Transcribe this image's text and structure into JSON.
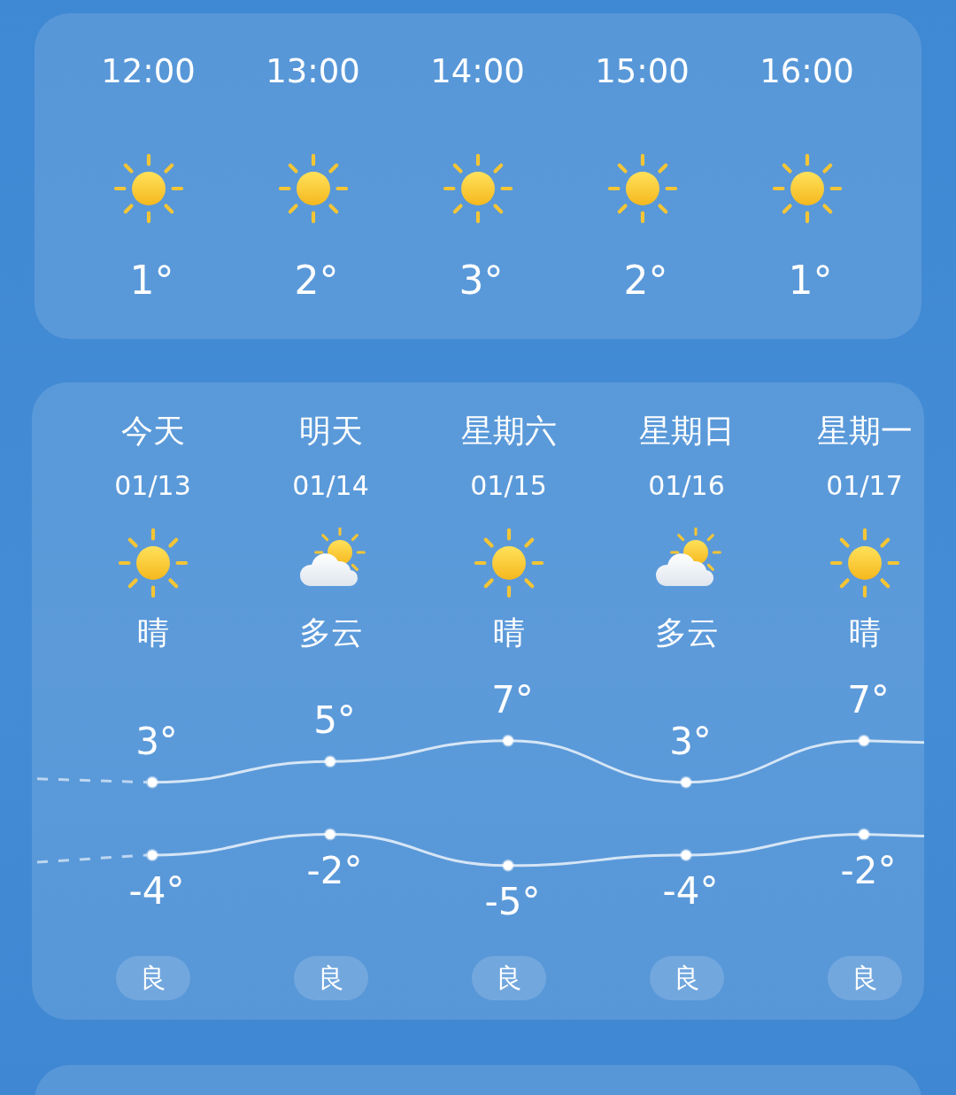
{
  "hourly": [
    {
      "time": "12:00",
      "kind": "sunny",
      "temp": "1°"
    },
    {
      "time": "13:00",
      "kind": "sunny",
      "temp": "2°"
    },
    {
      "time": "14:00",
      "kind": "sunny",
      "temp": "3°"
    },
    {
      "time": "15:00",
      "kind": "sunny",
      "temp": "2°"
    },
    {
      "time": "16:00",
      "kind": "sunny",
      "temp": "1°"
    }
  ],
  "daily": [
    {
      "day": "今天",
      "date": "01/13",
      "kind": "sunny",
      "condition": "晴",
      "high": "3°",
      "low": "-4°",
      "aqi": "良"
    },
    {
      "day": "明天",
      "date": "01/14",
      "kind": "cloudy",
      "condition": "多云",
      "high": "5°",
      "low": "-2°",
      "aqi": "良"
    },
    {
      "day": "星期六",
      "date": "01/15",
      "kind": "sunny",
      "condition": "晴",
      "high": "7°",
      "low": "-5°",
      "aqi": "良"
    },
    {
      "day": "星期日",
      "date": "01/16",
      "kind": "cloudy",
      "condition": "多云",
      "high": "3°",
      "low": "-4°",
      "aqi": "良"
    },
    {
      "day": "星期一",
      "date": "01/17",
      "kind": "sunny",
      "condition": "晴",
      "high": "7°",
      "low": "-2°",
      "aqi": "良"
    }
  ]
}
